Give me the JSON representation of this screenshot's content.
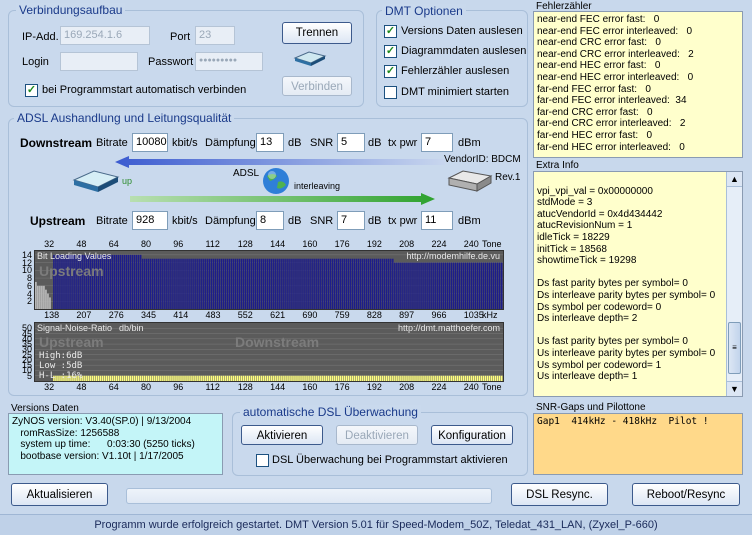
{
  "connection": {
    "title": "Verbindungsaufbau",
    "ip_label": "IP-Add.",
    "ip_value": "169.254.1.6",
    "port_label": "Port",
    "port_value": "23",
    "login_label": "Login",
    "login_value": "",
    "password_label": "Passwort",
    "password_value": "●●●●●●●●●",
    "disconnect_label": "Trennen",
    "connect_label": "Verbinden",
    "autoconnect_label": "bei Programmstart automatisch verbinden",
    "autoconnect_checked": true
  },
  "dmt_options": {
    "title": "DMT Optionen",
    "items": [
      {
        "label": "Versions Daten auslesen",
        "checked": true
      },
      {
        "label": "Diagrammdaten auslesen",
        "checked": true
      },
      {
        "label": "Fehlerzähler auslesen",
        "checked": true
      },
      {
        "label": "DMT minimiert starten",
        "checked": false
      }
    ]
  },
  "adsl": {
    "title": "ADSL Aushandlung und Leitungsqualität",
    "downstream": {
      "label": "Downstream",
      "bitrate_label": "Bitrate",
      "bitrate": "10080",
      "bitrate_unit": "kbit/s",
      "damping_label": "Dämpfung",
      "damping": "13",
      "damping_unit": "dB",
      "snr_label": "SNR",
      "snr": "5",
      "snr_unit": "dB",
      "txpwr_label": "tx pwr",
      "txpwr": "7",
      "txpwr_unit": "dBm"
    },
    "upstream": {
      "label": "Upstream",
      "bitrate_label": "Bitrate",
      "bitrate": "928",
      "bitrate_unit": "kbit/s",
      "damping_label": "Dämpfung",
      "damping": "8",
      "damping_unit": "dB",
      "snr_label": "SNR",
      "snr": "7",
      "snr_unit": "dB",
      "txpwr_label": "tx pwr",
      "txpwr": "11",
      "txpwr_unit": "dBm"
    },
    "modem_status": "up",
    "link_label": "ADSL",
    "mode_label": "interleaving",
    "vendor_label": "VendorID: BDCM",
    "vendor_rev": "Rev.1"
  },
  "chart_data": [
    {
      "type": "bar",
      "title": "Bit Loading Values",
      "watermark": "http://modemhilfe.de.vu",
      "region_label": "Upstream",
      "tone_ticks": [
        "32",
        "48",
        "64",
        "80",
        "96",
        "112",
        "128",
        "144",
        "160",
        "176",
        "192",
        "208",
        "224",
        "240"
      ],
      "tone_unit": "Tone",
      "khz_ticks": [
        "138",
        "207",
        "276",
        "345",
        "414",
        "483",
        "552",
        "621",
        "690",
        "759",
        "828",
        "897",
        "966",
        "1035"
      ],
      "khz_unit": "kHz",
      "yticks": [
        "14",
        "12",
        "10",
        "8",
        "6",
        "4",
        "2"
      ],
      "ylim": [
        0,
        15
      ],
      "series": [
        {
          "name": "Upstream",
          "color": "#b8b8b8",
          "from_tone": 7,
          "to_tone": 31,
          "values": [
            2,
            3,
            4,
            5,
            5,
            6,
            6,
            6,
            7,
            7,
            7,
            7,
            7,
            7,
            7,
            7,
            7,
            7,
            6,
            6,
            6,
            6,
            5,
            4,
            3
          ]
        },
        {
          "name": "Downstream",
          "color": "#1d1d8a",
          "from_tone": 33,
          "to_tone": 255,
          "value_profile": [
            [
              33,
              14
            ],
            [
              75,
              14
            ],
            [
              76,
              13
            ],
            [
              200,
              13
            ],
            [
              201,
              12
            ],
            [
              255,
              12
            ]
          ]
        }
      ]
    },
    {
      "type": "bar",
      "title": "Signal-Noise-Ratio",
      "ylabel": "db/bin",
      "watermark": "http://dmt.matthoefer.com",
      "region_labels": [
        "Upstream",
        "Downstream"
      ],
      "legend": [
        "High:6dB",
        "Low :5dB",
        "H-L :16%"
      ],
      "tone_ticks": [
        "32",
        "48",
        "64",
        "80",
        "96",
        "112",
        "128",
        "144",
        "160",
        "176",
        "192",
        "208",
        "224",
        "240"
      ],
      "tone_unit": "Tone",
      "yticks": [
        "50",
        "45",
        "40",
        "35",
        "30",
        "25",
        "20",
        "15",
        "10",
        "5"
      ],
      "ylim": [
        0,
        55
      ],
      "series": [
        {
          "name": "SNR",
          "color": "#ffff80",
          "from_tone": 33,
          "to_tone": 255,
          "values_db": 5
        }
      ]
    }
  ],
  "versions": {
    "title": "Versions Daten",
    "lines": [
      "ZyNOS version: V3.40(SP.0) | 9/13/2004",
      "   romRasSize: 1256588",
      "   system up time:      0:03:30 (5250 ticks)",
      "   bootbase version: V1.10t | 1/17/2005"
    ]
  },
  "monitor": {
    "title": "automatische DSL Überwachung",
    "activate_label": "Aktivieren",
    "deactivate_label": "Deaktivieren",
    "config_label": "Konfiguration",
    "auto_label": "DSL Überwachung bei Programmstart aktivieren",
    "auto_checked": false
  },
  "errors": {
    "title": "Fehlerzähler",
    "lines": [
      "near-end FEC error fast:   0",
      "near-end FEC error interleaved:   0",
      "near-end CRC error fast:   0",
      "near-end CRC error interleaved:   2",
      "near-end HEC error fast:   0",
      "near-end HEC error interleaved:   0",
      "far-end FEC error fast:   0",
      "far-end FEC error interleaved:  34",
      "far-end CRC error fast:   0",
      "far-end CRC error interleaved:   2",
      "far-end HEC error fast:   0",
      "far-end HEC error interleaved:   0"
    ]
  },
  "extra_info": {
    "title": "Extra Info",
    "lines": [
      "",
      "vpi_vpi_val = 0x00000000",
      "stdMode = 3",
      "atucVendorId = 0x4d434442",
      "atucRevisionNum = 1",
      "idleTick = 18229",
      "initTick = 18568",
      "showtimeTick = 19298",
      "",
      "Ds fast parity bytes per symbol= 0",
      "Ds interleave parity bytes per symbol= 0",
      "Ds symbol per codeword= 0",
      "Ds interleave depth= 2",
      "",
      "Us fast parity bytes per symbol= 0",
      "Us interleave parity bytes per symbol= 0",
      "Us symbol per codeword= 1",
      "Us interleave depth= 1"
    ]
  },
  "snr_gaps": {
    "title": "SNR-Gaps und Pilottone",
    "line": "Gap1  414kHz - 418kHz  Pilot !"
  },
  "bottom": {
    "refresh_label": "Aktualisieren",
    "resync_label": "DSL Resync.",
    "reboot_label": "Reboot/Resync",
    "progress": 0
  },
  "status": "Programm wurde erfolgreich gestartet. DMT Version 5.01 für Speed-Modem_50Z, Teledat_431_LAN, (Zyxel_P-660)"
}
